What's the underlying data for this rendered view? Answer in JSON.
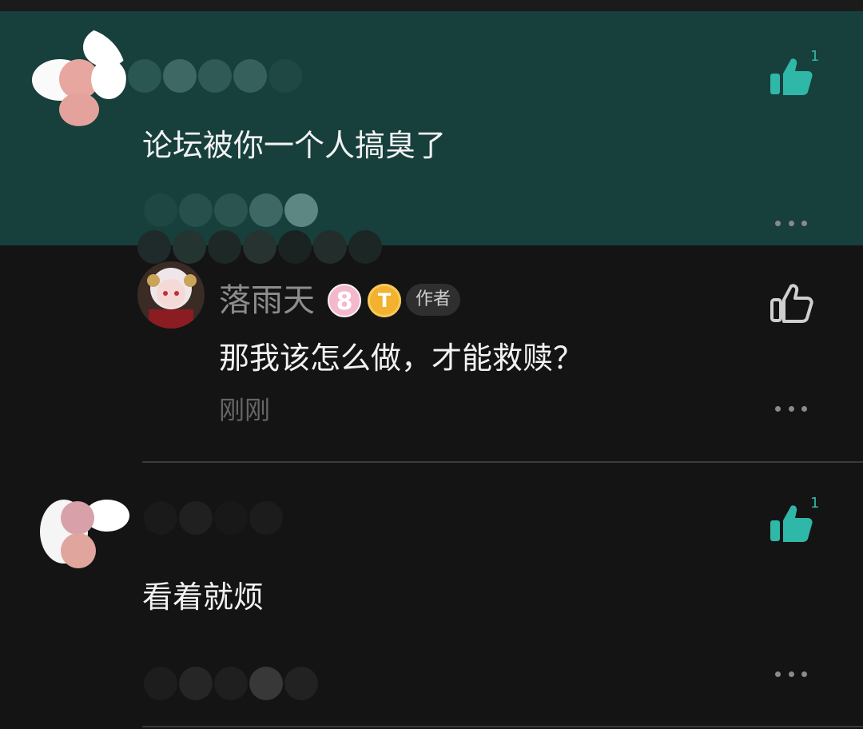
{
  "comments": [
    {
      "text": "论坛被你一个人搞臭了",
      "like_count": "1"
    },
    {
      "text": "看着就烦",
      "like_count": "1"
    }
  ],
  "reply": {
    "username": "落雨天",
    "level": "8",
    "author_badge": "作者",
    "text": "那我该怎么做，才能救赎？",
    "timestamp": "刚刚"
  },
  "colors": {
    "highlight_bg": "#173f3c",
    "accent": "#2fb7a8",
    "background": "#141414"
  },
  "icons": {
    "like_filled": "thumbs-up-filled-icon",
    "like_outline": "thumbs-up-outline-icon",
    "more": "more-horizontal-icon",
    "coin": "coin-badge-icon"
  }
}
